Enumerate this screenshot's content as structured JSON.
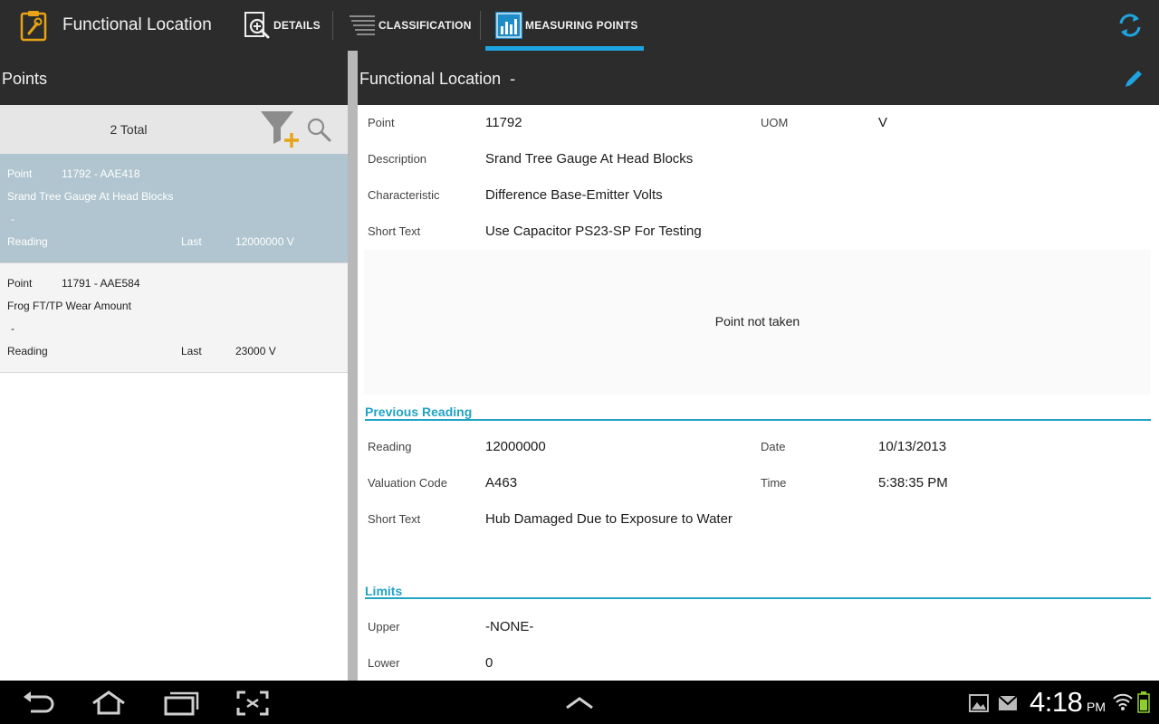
{
  "app": {
    "title": "Functional Location",
    "icon": "clipboard-wrench-icon"
  },
  "tabs": [
    {
      "label": "DETAILS",
      "icon": "details-magnify-icon",
      "selected": false
    },
    {
      "label": "CLASSIFICATION",
      "icon": "classification-list-icon",
      "selected": false
    },
    {
      "label": "MEASURING POINTS",
      "icon": "bar-chart-icon",
      "selected": true
    }
  ],
  "accent_color": "#1ea4e0",
  "section_color": "#21a3c4",
  "left_panel": {
    "title": "Points",
    "total": "2 Total",
    "items": [
      {
        "label": "Point",
        "id": "11792 - AAE418",
        "description": "Srand Tree Gauge At Head Blocks",
        "dash": "-",
        "reading_label": "Reading",
        "last_label": "Last",
        "last_value": "12000000 V",
        "selected": true
      },
      {
        "label": "Point",
        "id": "11791 - AAE584",
        "description": "Frog FT/TP Wear Amount",
        "dash": "-",
        "reading_label": "Reading",
        "last_label": "Last",
        "last_value": "23000 V",
        "selected": false
      }
    ]
  },
  "detail": {
    "title": "Functional Location  -",
    "point_label": "Point",
    "point_value": "11792",
    "uom_label": "UOM",
    "uom_value": "V",
    "description_label": "Description",
    "description_value": "Srand Tree Gauge At Head Blocks",
    "characteristic_label": "Characteristic",
    "characteristic_value": "Difference Base-Emitter Volts",
    "short_text_label": "Short Text",
    "short_text_value": "Use Capacitor PS23-SP For Testing",
    "notice": "Point not taken",
    "previous_reading": {
      "title": "Previous Reading",
      "reading_label": "Reading",
      "reading_value": "12000000",
      "date_label": "Date",
      "date_value": "10/13/2013",
      "valuation_label": "Valuation Code",
      "valuation_value": "A463",
      "time_label": "Time",
      "time_value": "5:38:35 PM",
      "short_text_label": "Short Text",
      "short_text_value": "Hub Damaged Due to Exposure to Water"
    },
    "limits": {
      "title": "Limits",
      "upper_label": "Upper",
      "upper_value": "-NONE-",
      "lower_label": "Lower",
      "lower_value": "0"
    }
  },
  "system_bar": {
    "time": "4:18",
    "ampm": "PM"
  }
}
